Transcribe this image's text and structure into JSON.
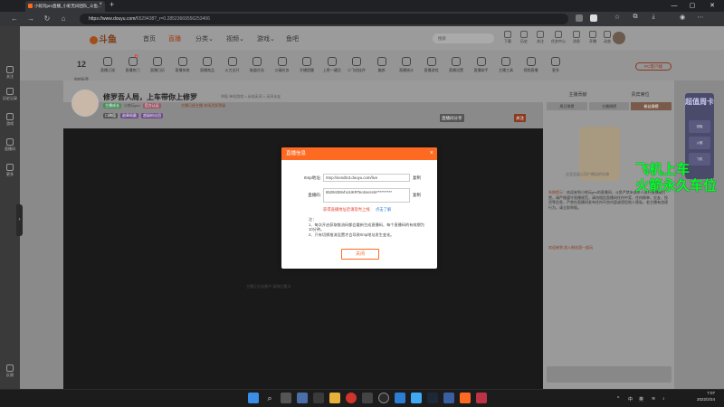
{
  "browser": {
    "tab_title": "小蛇玩pro直播_小蛇无间团队_斗鱼...",
    "url_host": "https://www.douyu.com/",
    "url_path": "6529438?_r=0.28523669556253406",
    "new_tab": "+",
    "window_controls": [
      "—",
      "▢",
      "✕"
    ]
  },
  "leftnav": {
    "items": [
      {
        "label": "关注",
        "icon": "heart-icon"
      },
      {
        "label": "历史记录",
        "icon": "history-icon"
      },
      {
        "label": "游戏",
        "icon": "gamepad-icon"
      },
      {
        "label": "直播间",
        "icon": "tv-icon"
      },
      {
        "label": "更多",
        "icon": "more-icon"
      }
    ],
    "bottom": "反馈"
  },
  "topnav": {
    "logo": "斗鱼",
    "links": [
      "首页",
      "直播",
      "分类",
      "视频",
      "游戏",
      "鱼吧"
    ],
    "active": "直播",
    "search_placeholder": "搜索",
    "header_icons": [
      "下载",
      "历史",
      "关注",
      "任务中心",
      "消息",
      "开播",
      "动态"
    ]
  },
  "categories": {
    "count": "12",
    "count_label": "你的标签",
    "items": [
      {
        "label": "直播订阅",
        "badge": ""
      },
      {
        "label": "直播热门",
        "badge": "1"
      },
      {
        "label": "直播日历",
        "badge": ""
      },
      {
        "label": "直播系统",
        "badge": ""
      },
      {
        "label": "直播商品",
        "badge": ""
      },
      {
        "label": "火力全开",
        "badge": ""
      },
      {
        "label": "能量任务",
        "badge": ""
      },
      {
        "label": "沙漏任务",
        "badge": ""
      },
      {
        "label": "开播提醒",
        "badge": ""
      },
      {
        "label": "上榜一键回",
        "badge": ""
      },
      {
        "label": "小飞机挂件",
        "badge": ""
      },
      {
        "label": "美颜",
        "badge": ""
      },
      {
        "label": "直播统计",
        "badge": ""
      },
      {
        "label": "直播游戏",
        "badge": ""
      },
      {
        "label": "直播设置",
        "badge": ""
      },
      {
        "label": "直播助手",
        "badge": ""
      },
      {
        "label": "主播工具",
        "badge": ""
      },
      {
        "label": "视频直播",
        "badge": ""
      },
      {
        "label": "更多",
        "badge": ""
      }
    ],
    "pc_client": "PC客户端"
  },
  "room": {
    "title": "修罗吾人局，上车带你上修罗",
    "meta": "举报   单机游戏 > 永劫无间 > 无间水友",
    "tags": [
      "主播成长",
      "小蛇玩pro",
      "官方认证"
    ],
    "side_info": "主播已经主播 本场活跃等级",
    "chips": [
      "口碑值",
      "勋章佩戴",
      "超级粉丝团"
    ],
    "buttons": [
      "直播间分享",
      "关注"
    ]
  },
  "player": {
    "note": "主播正在准备中 请稍后重试"
  },
  "rightpanel": {
    "tabs": [
      "主播贡献",
      "贵宾席位"
    ],
    "subtabs": [
      "周日常榜",
      "主播周榜",
      "粉丝周榜"
    ],
    "illust_caption": "这里会展示用户赠送的礼物",
    "notice_label": "系统提示：",
    "notice_text": "欢迎来到小蛇玩pro的直播间，斗鱼严禁未成年人进行直播或打赏，请严格遵守直播规范，请勿相信直播间任何中奖、任何刷单、交友、投资等信息，严禁在直播间发布任何不良内容或侵犯他人隐私，若主播有违规行为，请立即举报。",
    "welcome": "欢迎来到 加入粉丝团一起玩",
    "banner_title": "超值周卡",
    "banner_items": [
      "领取",
      "火箭",
      "飞机"
    ]
  },
  "overlay": {
    "line1": "飞机上车",
    "line2": "火箭永久车位"
  },
  "modal": {
    "title": "直播信息",
    "rtmp_label": "rtmp地址:",
    "rtmp_value": "rtmp://sendtc3.douyu.com/live",
    "key_label": "直播码:",
    "key_value": "6529438rvhUUKRTeoSecrets**********",
    "copy_label": "复制",
    "warning": "获得直播地址后请及时上线",
    "learn_more": "点击了解",
    "notes_title": "注：",
    "note1": "1、每次开启获取推流码都会重新生成直播码，每个直播码的有效期为10分钟。",
    "note2": "2、只有切换推流设置才会导致rtmp地址发生变化。",
    "close_button": "关闭"
  },
  "taskbar": {
    "time": "7:07",
    "date": "2022/2/24",
    "tray": [
      "^",
      "中",
      "英"
    ]
  },
  "colors": {
    "accent": "#ff6a22",
    "overlay_green": "#00ff2a",
    "warning_red": "#e03e2d",
    "link_blue": "#2b7bd6"
  }
}
